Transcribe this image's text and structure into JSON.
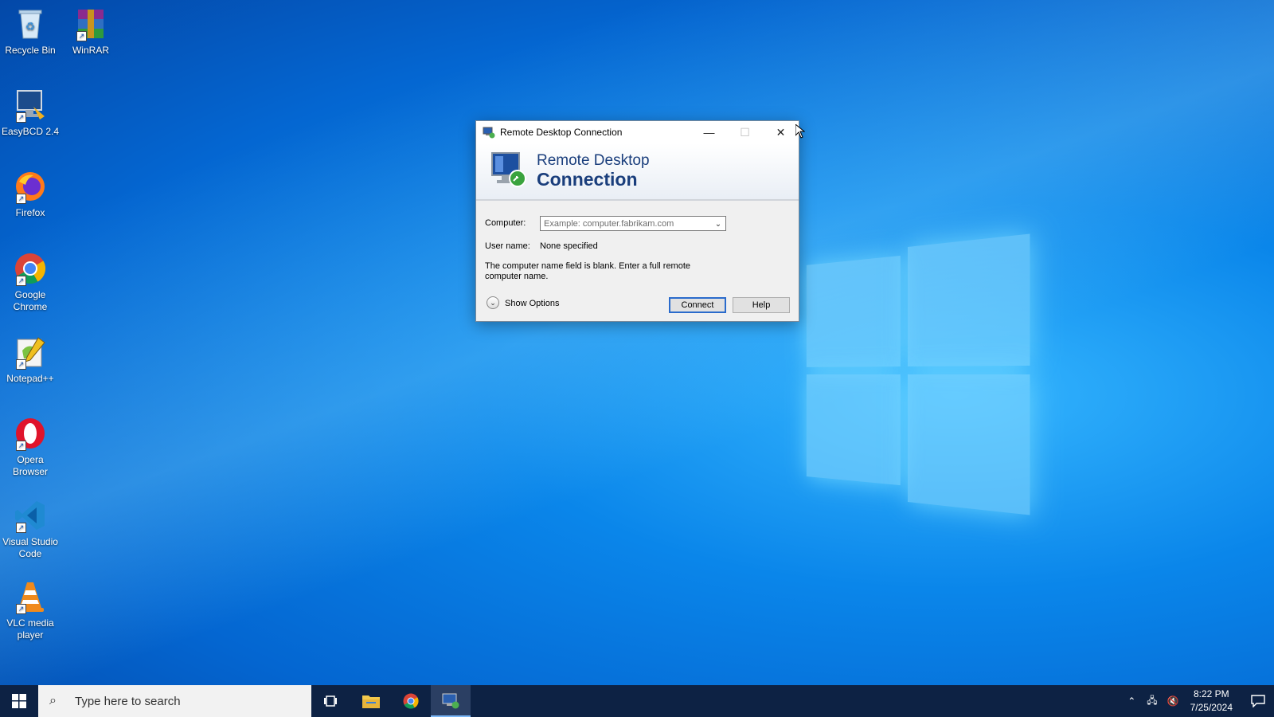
{
  "desktop": {
    "icons": [
      {
        "label": "Recycle Bin",
        "icon": "recycle-bin-icon"
      },
      {
        "label": "WinRAR",
        "icon": "winrar-icon"
      },
      {
        "label": "EasyBCD 2.4",
        "icon": "easybcd-icon"
      },
      {
        "label": "Firefox",
        "icon": "firefox-icon"
      },
      {
        "label": "Google Chrome",
        "icon": "chrome-icon"
      },
      {
        "label": "Notepad++",
        "icon": "notepadpp-icon"
      },
      {
        "label": "Opera Browser",
        "icon": "opera-icon"
      },
      {
        "label": "Visual Studio Code",
        "icon": "vscode-icon"
      },
      {
        "label": "VLC media player",
        "icon": "vlc-icon"
      }
    ]
  },
  "dialog": {
    "title": "Remote Desktop Connection",
    "banner_line1": "Remote Desktop",
    "banner_line2": "Connection",
    "computer_label": "Computer:",
    "computer_placeholder": "Example: computer.fabrikam.com",
    "username_label": "User name:",
    "username_value": "None specified",
    "message": "The computer name field is blank. Enter a full remote computer name.",
    "show_options": "Show Options",
    "connect": "Connect",
    "help": "Help"
  },
  "taskbar": {
    "search_placeholder": "Type here to search",
    "time": "8:22 PM",
    "date": "7/25/2024",
    "apps": [
      "task-view",
      "file-explorer",
      "google-chrome",
      "remote-desktop-connection"
    ]
  },
  "colors": {
    "accent": "#2a6bcc",
    "taskbar": "#0d2244",
    "banner_text": "#1a3e7c"
  }
}
